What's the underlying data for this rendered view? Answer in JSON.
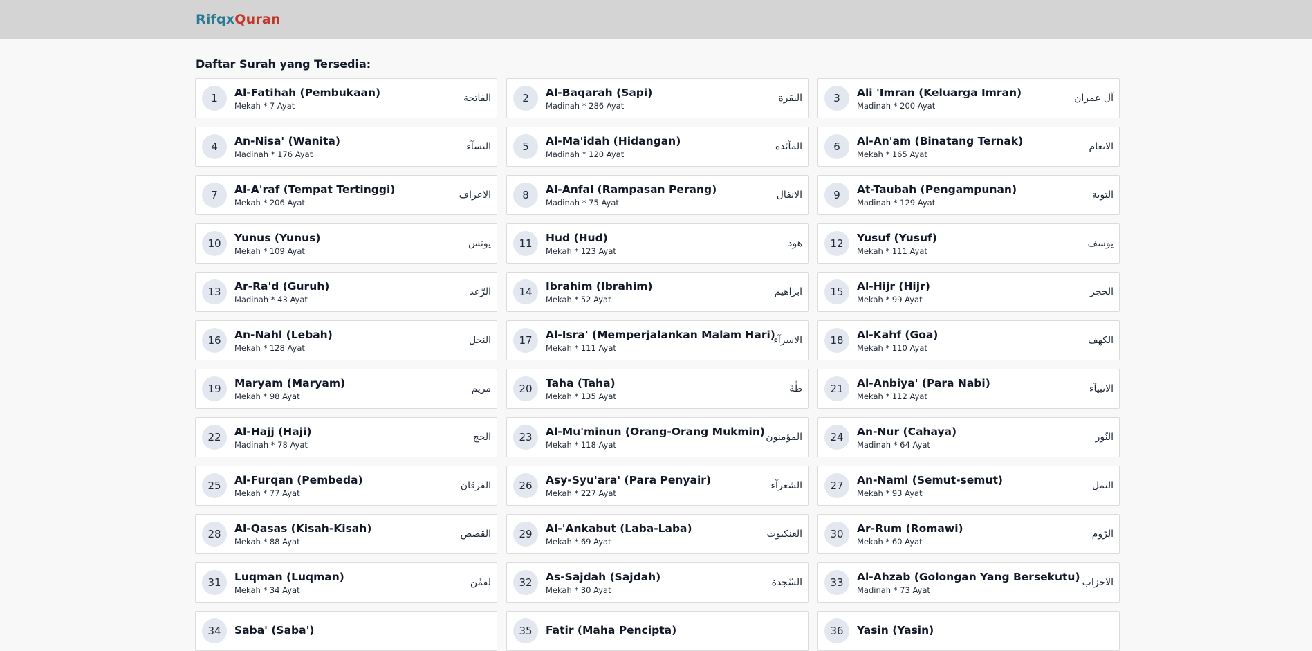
{
  "app": {
    "brand_part1": "Rifqx",
    "brand_part2": "Quran"
  },
  "heading": "Daftar Surah yang Tersedia:",
  "surahs": [
    {
      "number": "1",
      "name": "Al-Fatihah (Pembukaan)",
      "info": "Mekah * 7 Ayat",
      "arabic": "الفاتحة"
    },
    {
      "number": "2",
      "name": "Al-Baqarah (Sapi)",
      "info": "Madinah * 286 Ayat",
      "arabic": "البقرة"
    },
    {
      "number": "3",
      "name": "Ali 'Imran (Keluarga Imran)",
      "info": "Madinah * 200 Ayat",
      "arabic": "آل عمران"
    },
    {
      "number": "4",
      "name": "An-Nisa' (Wanita)",
      "info": "Madinah * 176 Ayat",
      "arabic": "النسآء"
    },
    {
      "number": "5",
      "name": "Al-Ma'idah (Hidangan)",
      "info": "Madinah * 120 Ayat",
      "arabic": "المآئدة"
    },
    {
      "number": "6",
      "name": "Al-An'am (Binatang Ternak)",
      "info": "Mekah * 165 Ayat",
      "arabic": "الانعام"
    },
    {
      "number": "7",
      "name": "Al-A'raf (Tempat Tertinggi)",
      "info": "Mekah * 206 Ayat",
      "arabic": "الاعراف"
    },
    {
      "number": "8",
      "name": "Al-Anfal (Rampasan Perang)",
      "info": "Madinah * 75 Ayat",
      "arabic": "الانفال"
    },
    {
      "number": "9",
      "name": "At-Taubah (Pengampunan)",
      "info": "Madinah * 129 Ayat",
      "arabic": "التوبة"
    },
    {
      "number": "10",
      "name": "Yunus (Yunus)",
      "info": "Mekah * 109 Ayat",
      "arabic": "يونس"
    },
    {
      "number": "11",
      "name": "Hud (Hud)",
      "info": "Mekah * 123 Ayat",
      "arabic": "هود"
    },
    {
      "number": "12",
      "name": "Yusuf (Yusuf)",
      "info": "Mekah * 111 Ayat",
      "arabic": "يوسف"
    },
    {
      "number": "13",
      "name": "Ar-Ra'd (Guruh)",
      "info": "Madinah * 43 Ayat",
      "arabic": "الرّعد"
    },
    {
      "number": "14",
      "name": "Ibrahim (Ibrahim)",
      "info": "Mekah * 52 Ayat",
      "arabic": "ابراهيم"
    },
    {
      "number": "15",
      "name": "Al-Hijr (Hijr)",
      "info": "Mekah * 99 Ayat",
      "arabic": "الحجر"
    },
    {
      "number": "16",
      "name": "An-Nahl (Lebah)",
      "info": "Mekah * 128 Ayat",
      "arabic": "النحل"
    },
    {
      "number": "17",
      "name": "Al-Isra' (Memperjalankan Malam Hari)",
      "info": "Mekah * 111 Ayat",
      "arabic": "الاسرآء"
    },
    {
      "number": "18",
      "name": "Al-Kahf (Goa)",
      "info": "Mekah * 110 Ayat",
      "arabic": "الكهف"
    },
    {
      "number": "19",
      "name": "Maryam (Maryam)",
      "info": "Mekah * 98 Ayat",
      "arabic": "مريم"
    },
    {
      "number": "20",
      "name": "Taha (Taha)",
      "info": "Mekah * 135 Ayat",
      "arabic": "طٰهٰ"
    },
    {
      "number": "21",
      "name": "Al-Anbiya' (Para Nabi)",
      "info": "Mekah * 112 Ayat",
      "arabic": "الانبيآء"
    },
    {
      "number": "22",
      "name": "Al-Hajj (Haji)",
      "info": "Madinah * 78 Ayat",
      "arabic": "الحج"
    },
    {
      "number": "23",
      "name": "Al-Mu'minun (Orang-Orang Mukmin)",
      "info": "Mekah * 118 Ayat",
      "arabic": "المؤمنون"
    },
    {
      "number": "24",
      "name": "An-Nur (Cahaya)",
      "info": "Madinah * 64 Ayat",
      "arabic": "النّور"
    },
    {
      "number": "25",
      "name": "Al-Furqan (Pembeda)",
      "info": "Mekah * 77 Ayat",
      "arabic": "الفرقان"
    },
    {
      "number": "26",
      "name": "Asy-Syu'ara' (Para Penyair)",
      "info": "Mekah * 227 Ayat",
      "arabic": "الشعرآء"
    },
    {
      "number": "27",
      "name": "An-Naml (Semut-semut)",
      "info": "Mekah * 93 Ayat",
      "arabic": "النمل"
    },
    {
      "number": "28",
      "name": "Al-Qasas (Kisah-Kisah)",
      "info": "Mekah * 88 Ayat",
      "arabic": "القصص"
    },
    {
      "number": "29",
      "name": "Al-'Ankabut (Laba-Laba)",
      "info": "Mekah * 69 Ayat",
      "arabic": "العنكبوت"
    },
    {
      "number": "30",
      "name": "Ar-Rum (Romawi)",
      "info": "Mekah * 60 Ayat",
      "arabic": "الرّوم"
    },
    {
      "number": "31",
      "name": "Luqman (Luqman)",
      "info": "Mekah * 34 Ayat",
      "arabic": "لقمٰن"
    },
    {
      "number": "32",
      "name": "As-Sajdah (Sajdah)",
      "info": "Mekah * 30 Ayat",
      "arabic": "السّجدة"
    },
    {
      "number": "33",
      "name": "Al-Ahzab (Golongan Yang Bersekutu)",
      "info": "Madinah * 73 Ayat",
      "arabic": "الاحزاب"
    },
    {
      "number": "34",
      "name": "Saba' (Saba')",
      "info": "",
      "arabic": ""
    },
    {
      "number": "35",
      "name": "Fatir (Maha Pencipta)",
      "info": "",
      "arabic": ""
    },
    {
      "number": "36",
      "name": "Yasin (Yasin)",
      "info": "",
      "arabic": ""
    }
  ]
}
